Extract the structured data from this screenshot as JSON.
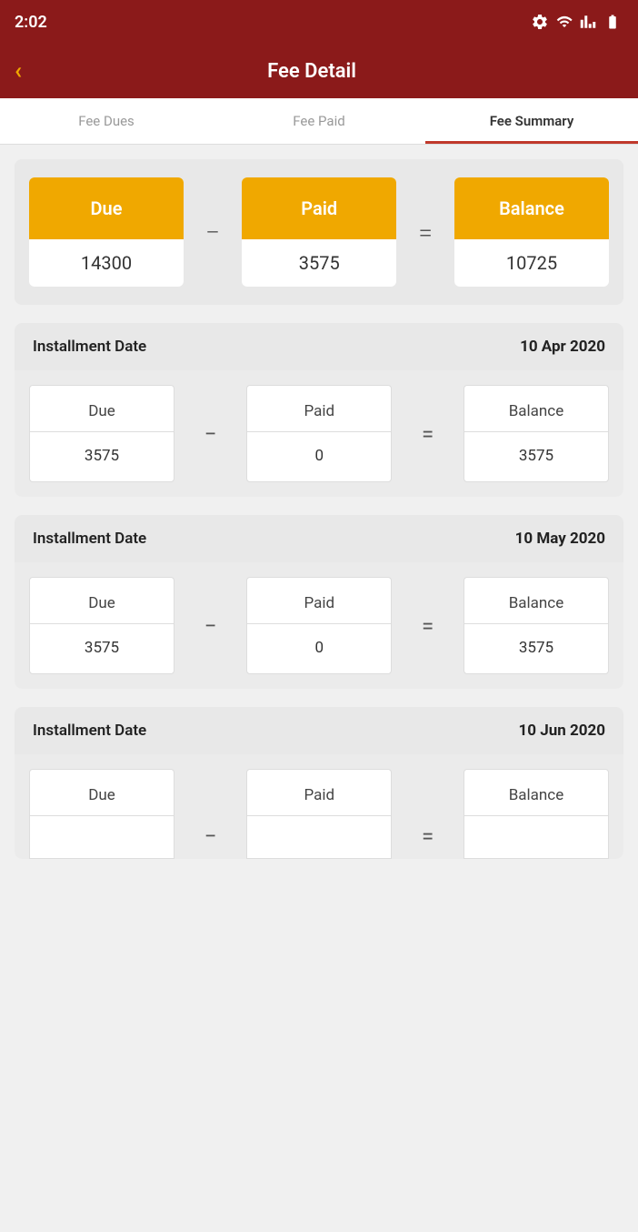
{
  "statusBar": {
    "time": "2:02"
  },
  "appBar": {
    "backLabel": "‹",
    "title": "Fee Detail"
  },
  "tabs": [
    {
      "label": "Fee Dues",
      "active": false
    },
    {
      "label": "Fee Paid",
      "active": false
    },
    {
      "label": "Fee Summary",
      "active": true
    }
  ],
  "summary": {
    "due": {
      "label": "Due",
      "value": "14300"
    },
    "paid": {
      "label": "Paid",
      "value": "3575"
    },
    "balance": {
      "label": "Balance",
      "value": "10725"
    }
  },
  "installments": [
    {
      "label": "Installment Date",
      "date": "10 Apr 2020",
      "due": "3575",
      "paid": "0",
      "balance": "3575"
    },
    {
      "label": "Installment Date",
      "date": "10 May 2020",
      "due": "3575",
      "paid": "0",
      "balance": "3575"
    },
    {
      "label": "Installment Date",
      "date": "10 Jun 2020",
      "due": "",
      "paid": "",
      "balance": "",
      "partial": true
    }
  ]
}
